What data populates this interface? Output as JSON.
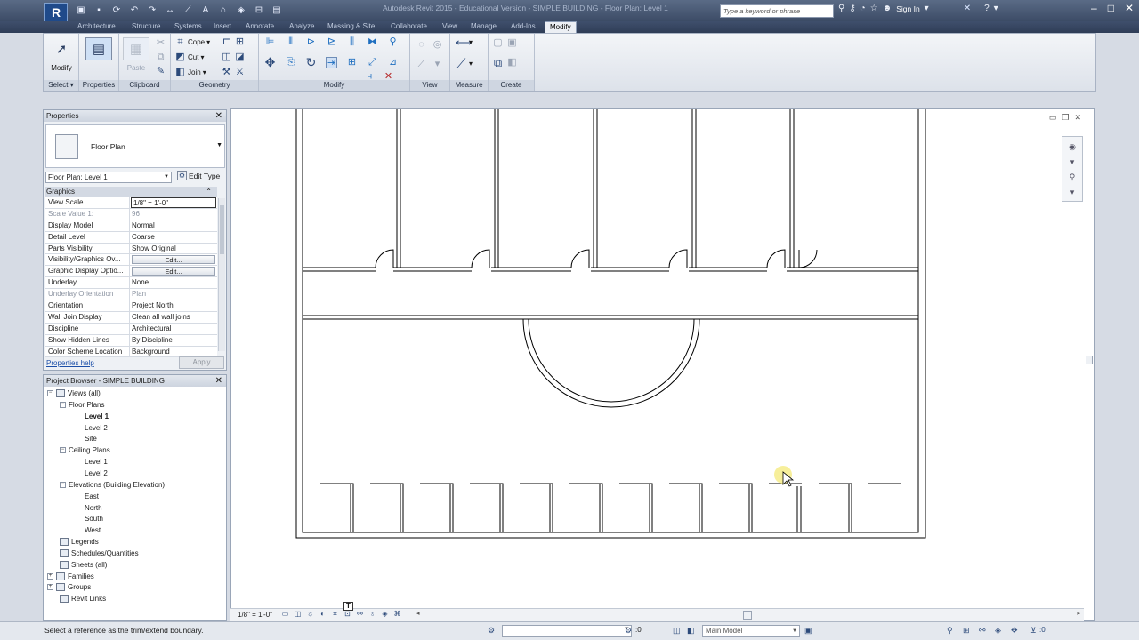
{
  "title_bar": {
    "app_logo": "R",
    "window_title": "Autodesk Revit 2015 - Educational Version -    SIMPLE BUILDING - Floor Plan: Level 1",
    "search_placeholder": "Type a keyword or phrase",
    "sign_in": "Sign In",
    "qat_icons": [
      "open-icon",
      "save-icon",
      "sync-icon",
      "undo-icon",
      "redo-icon",
      "measure-icon",
      "dimension-icon",
      "text-icon",
      "3d-view-icon",
      "section-icon",
      "close-hidden-icon",
      "switch-windows-icon"
    ]
  },
  "ribbon_tabs": [
    "Architecture",
    "Structure",
    "Systems",
    "Insert",
    "Annotate",
    "Analyze",
    "Massing & Site",
    "Collaborate",
    "View",
    "Manage",
    "Add-Ins",
    "Modify"
  ],
  "ribbon": {
    "modify_label": "Modify",
    "select_label": "Select",
    "properties_label": "Properties",
    "clipboard_label": "Clipboard",
    "paste_label": "Paste",
    "geometry_label": "Geometry",
    "cope_label": "Cope",
    "cut_label": "Cut",
    "join_label": "Join",
    "modify_panel_label": "Modify",
    "view_label": "View",
    "measure_label": "Measure",
    "create_label": "Create"
  },
  "properties": {
    "title": "Properties",
    "type_name": "Floor Plan",
    "instance": "Floor Plan: Level 1",
    "edit_type": "Edit Type",
    "group": "Graphics",
    "rows": [
      {
        "name": "View Scale",
        "value": "1/8\" = 1'-0\"",
        "kind": "boxed"
      },
      {
        "name": "Scale Value    1:",
        "value": "96",
        "kind": "disabled"
      },
      {
        "name": "Display Model",
        "value": "Normal",
        "kind": "text"
      },
      {
        "name": "Detail Level",
        "value": "Coarse",
        "kind": "text"
      },
      {
        "name": "Parts Visibility",
        "value": "Show Original",
        "kind": "text"
      },
      {
        "name": "Visibility/Graphics Ov...",
        "value": "Edit...",
        "kind": "button"
      },
      {
        "name": "Graphic Display Optio...",
        "value": "Edit...",
        "kind": "button"
      },
      {
        "name": "Underlay",
        "value": "None",
        "kind": "text"
      },
      {
        "name": "Underlay Orientation",
        "value": "Plan",
        "kind": "disabled"
      },
      {
        "name": "Orientation",
        "value": "Project North",
        "kind": "text"
      },
      {
        "name": "Wall Join Display",
        "value": "Clean all wall joins",
        "kind": "text"
      },
      {
        "name": "Discipline",
        "value": "Architectural",
        "kind": "text"
      },
      {
        "name": "Show Hidden Lines",
        "value": "By Discipline",
        "kind": "text"
      },
      {
        "name": "Color Scheme Location",
        "value": "Background",
        "kind": "text"
      }
    ],
    "help": "Properties help",
    "apply": "Apply"
  },
  "browser": {
    "title": "Project Browser - SIMPLE BUILDING",
    "items": [
      {
        "label": "Views (all)",
        "level": 0,
        "toggle": "−",
        "icon": true
      },
      {
        "label": "Floor Plans",
        "level": 1,
        "toggle": "−"
      },
      {
        "label": "Level 1",
        "level": 2,
        "bold": true
      },
      {
        "label": "Level 2",
        "level": 2
      },
      {
        "label": "Site",
        "level": 2
      },
      {
        "label": "Ceiling Plans",
        "level": 1,
        "toggle": "−"
      },
      {
        "label": "Level 1",
        "level": 2
      },
      {
        "label": "Level 2",
        "level": 2
      },
      {
        "label": "Elevations (Building Elevation)",
        "level": 1,
        "toggle": "−"
      },
      {
        "label": "East",
        "level": 2
      },
      {
        "label": "North",
        "level": 2
      },
      {
        "label": "South",
        "level": 2
      },
      {
        "label": "West",
        "level": 2
      },
      {
        "label": "Legends",
        "level": 0,
        "icon": true
      },
      {
        "label": "Schedules/Quantities",
        "level": 0,
        "icon": true
      },
      {
        "label": "Sheets (all)",
        "level": 0,
        "icon": true
      },
      {
        "label": "Families",
        "level": 0,
        "toggle": "+",
        "icon": true
      },
      {
        "label": "Groups",
        "level": 0,
        "toggle": "+",
        "icon": true
      },
      {
        "label": "Revit Links",
        "level": 0,
        "icon": true
      }
    ]
  },
  "view_bar": {
    "scale": "1/8\" = 1'-0\""
  },
  "status_bar": {
    "message": "Select a reference as the trim/extend boundary.",
    "coord": ":0",
    "model": "Main Model"
  },
  "colors": {
    "accent": "#1f4a8a",
    "title_bar": "#3c4b66",
    "cursor_highlight": "#f6ec8a"
  }
}
